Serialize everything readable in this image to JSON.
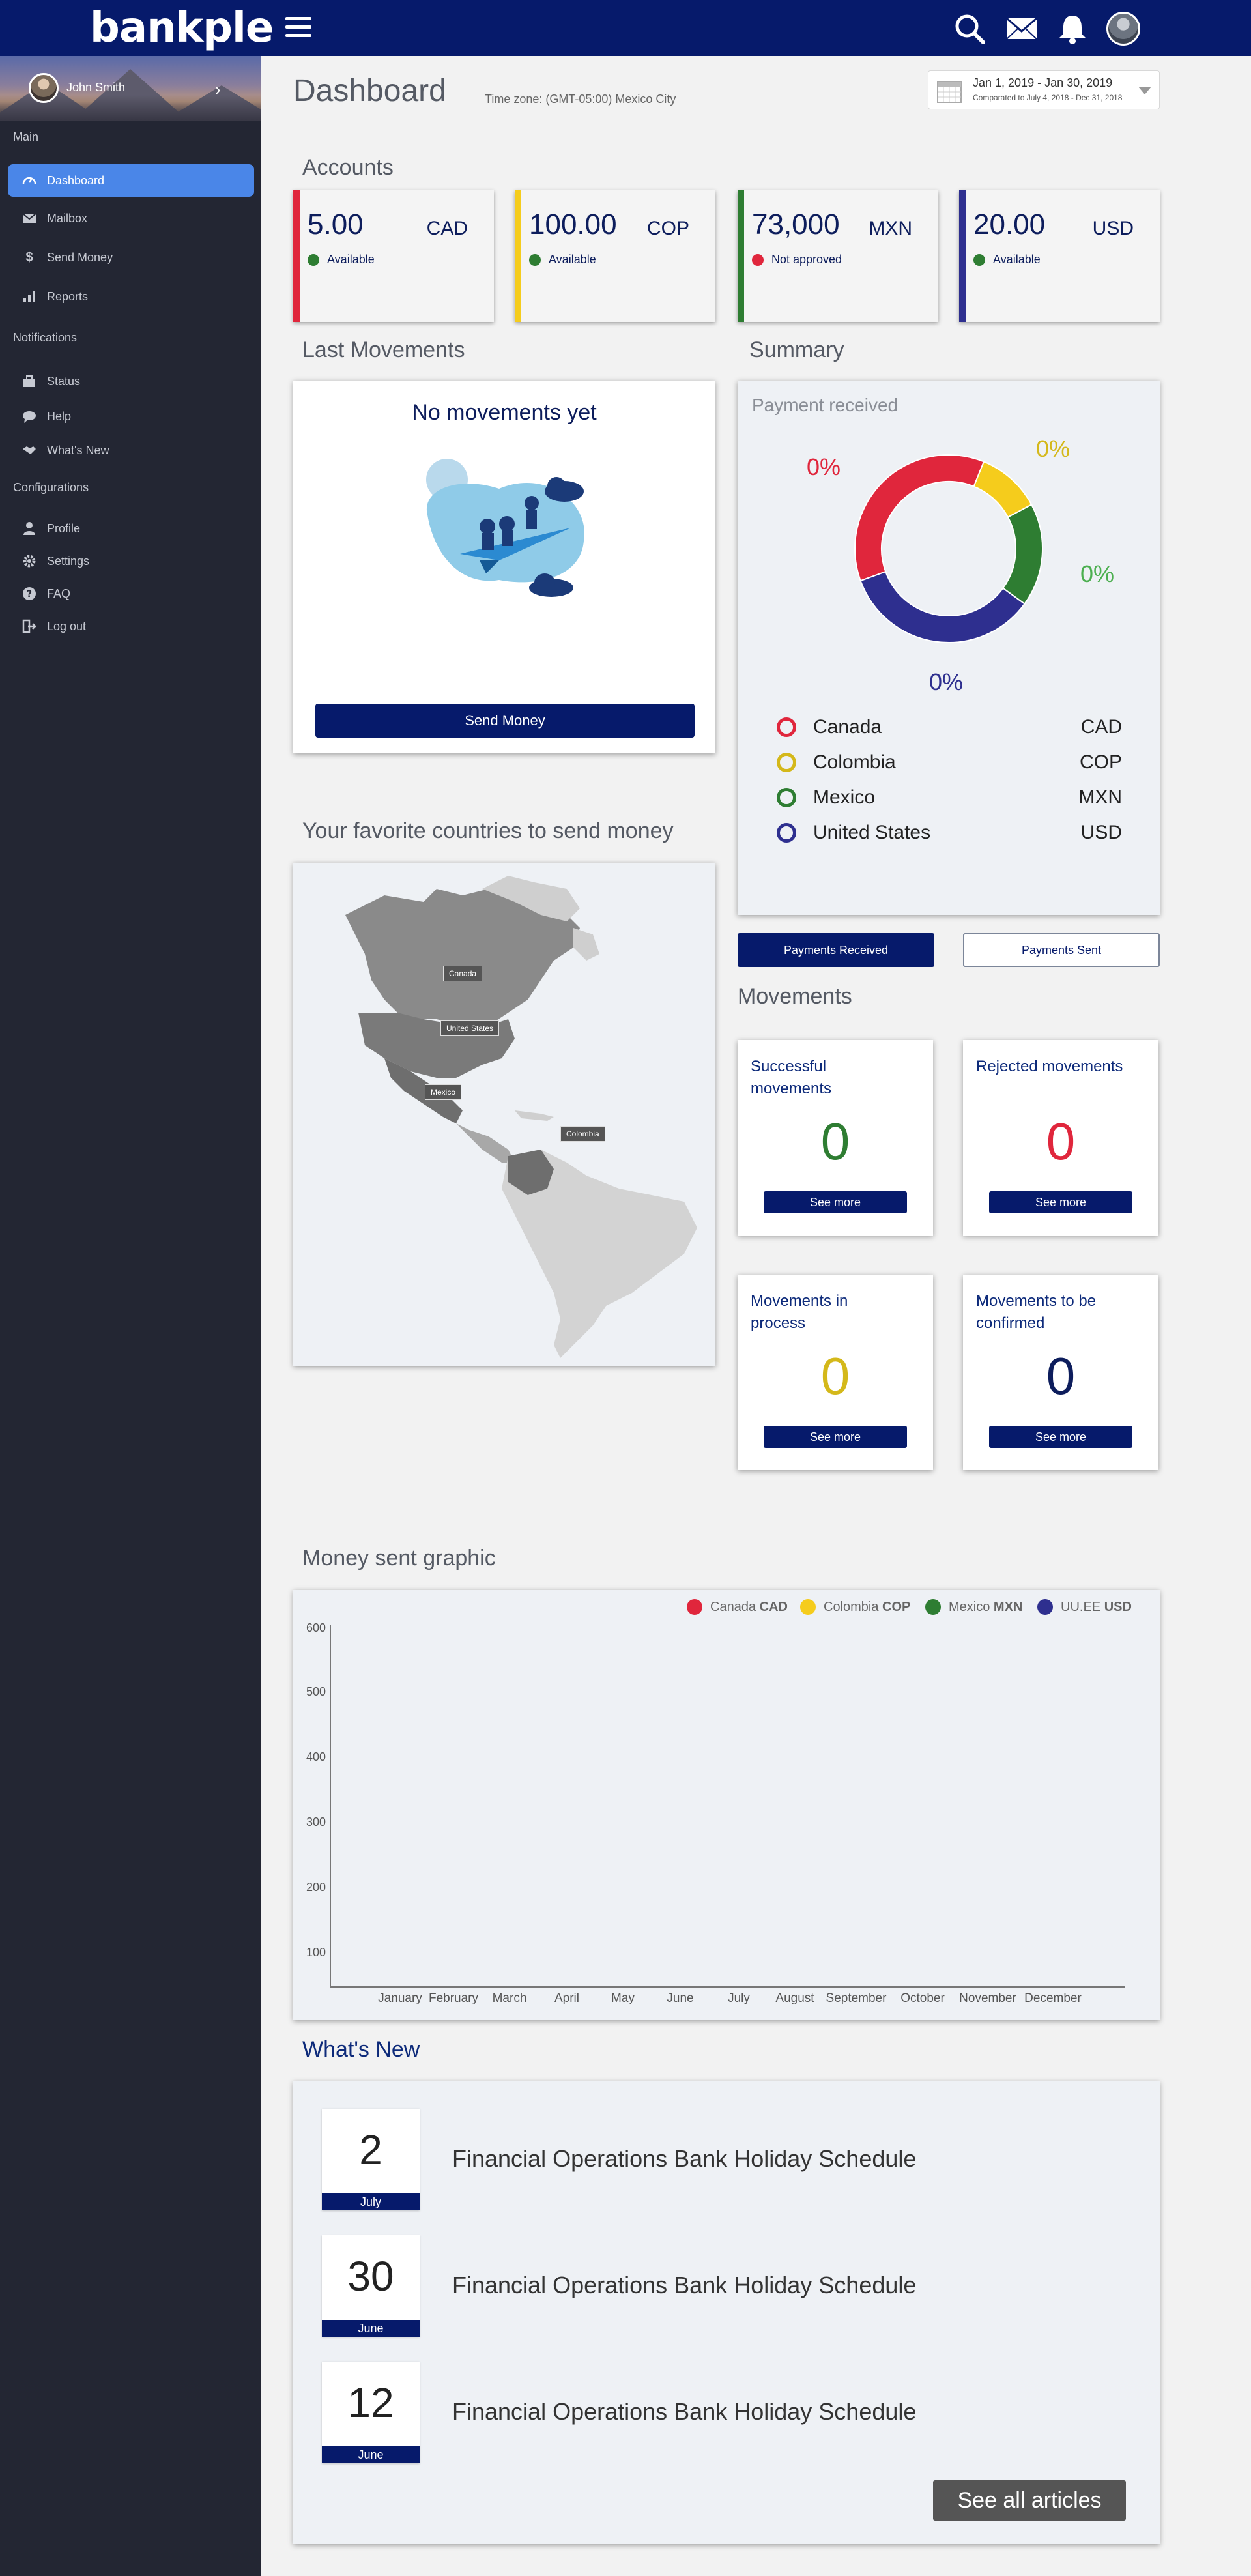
{
  "app": {
    "logo": "bankple"
  },
  "sidebar": {
    "user_name": "John Smith",
    "sections": {
      "main": "Main",
      "notifications": "Notifications",
      "configurations": "Configurations"
    },
    "items": [
      {
        "label": "Dashboard",
        "icon": "speedometer-icon"
      },
      {
        "label": "Mailbox",
        "icon": "envelope-icon"
      },
      {
        "label": "Send Money",
        "icon": "money-icon"
      },
      {
        "label": "Reports",
        "icon": "bar-chart-icon"
      },
      {
        "label": "Status",
        "icon": "briefcase-icon"
      },
      {
        "label": "Help",
        "icon": "chat-bubble-icon"
      },
      {
        "label": "What's New",
        "icon": "handshake-icon"
      },
      {
        "label": "Profile",
        "icon": "user-icon"
      },
      {
        "label": "Settings",
        "icon": "gear-icon"
      },
      {
        "label": "FAQ",
        "icon": "question-icon"
      },
      {
        "label": "Log out",
        "icon": "logout-icon"
      }
    ]
  },
  "header": {
    "title": "Dashboard",
    "timezone": "Time zone: (GMT-05:00) Mexico City",
    "date_range": "Jan 1, 2019 - Jan 30, 2019",
    "date_compare": "Comparated to July 4, 2018 - Dec 31, 2018"
  },
  "accounts": {
    "title": "Accounts",
    "cards": [
      {
        "amount": "5.00",
        "currency": "CAD",
        "status": "Available",
        "color": "#e0263c",
        "status_color": "#2e7d32"
      },
      {
        "amount": "100.00",
        "currency": "COP",
        "status": "Available",
        "color": "#f5cc1c",
        "status_color": "#2e7d32"
      },
      {
        "amount": "73,000",
        "currency": "MXN",
        "status": "Not approved",
        "color": "#2e7d32",
        "status_color": "#e0263c"
      },
      {
        "amount": "20.00",
        "currency": "USD",
        "status": "Available",
        "color": "#2e2f8f",
        "status_color": "#2e7d32"
      }
    ]
  },
  "last_movements": {
    "title": "Last Movements",
    "empty_text": "No movements yet",
    "button": "Send Money"
  },
  "summary": {
    "title": "Summary",
    "subtitle": "Payment received",
    "percentages": {
      "canada": "0%",
      "colombia": "0%",
      "mexico": "0%",
      "usa": "0%"
    },
    "legend": [
      {
        "country": "Canada",
        "code": "CAD",
        "color": "#e0263c"
      },
      {
        "country": "Colombia",
        "code": "COP",
        "color": "#d4b81a"
      },
      {
        "country": "Mexico",
        "code": "MXN",
        "color": "#2e7d32"
      },
      {
        "country": "United States",
        "code": "USD",
        "color": "#2e2f8f"
      }
    ],
    "buttons": {
      "received": "Payments Received",
      "sent": "Payments Sent"
    }
  },
  "favorites": {
    "title": "Your favorite countries to send money",
    "labels": {
      "canada": "Canada",
      "usa": "United States",
      "mexico": "Mexico",
      "colombia": "Colombia"
    }
  },
  "movements": {
    "title": "Movements",
    "cards": [
      {
        "title": "Successful movements",
        "count": "0",
        "color": "#2e7d32",
        "button": "See more"
      },
      {
        "title": "Rejected movements",
        "count": "0",
        "color": "#e0263c",
        "button": "See more"
      },
      {
        "title": "Movements in process",
        "count": "0",
        "color": "#d4b81a",
        "button": "See more"
      },
      {
        "title": "Movements to be confirmed",
        "count": "0",
        "color": "#0d1d5c",
        "button": "See more"
      }
    ]
  },
  "money_sent_graphic": {
    "title": "Money sent graphic",
    "legend": [
      {
        "name": "Canada",
        "code": "CAD",
        "color": "#e0263c"
      },
      {
        "name": "Colombia",
        "code": "COP",
        "color": "#f5cc1c"
      },
      {
        "name": "Mexico",
        "code": "MXN",
        "color": "#2e7d32"
      },
      {
        "name": "UU.EE",
        "code": "USD",
        "color": "#2e2f8f"
      }
    ],
    "y_ticks": [
      "600",
      "500",
      "400",
      "300",
      "200",
      "100"
    ],
    "months": [
      "January",
      "February",
      "March",
      "April",
      "May",
      "June",
      "July",
      "August",
      "September",
      "October",
      "November",
      "December"
    ]
  },
  "whats_new": {
    "title": "What's New",
    "items": [
      {
        "day": "2",
        "month": "July",
        "title": "Financial Operations Bank Holiday Schedule"
      },
      {
        "day": "30",
        "month": "June",
        "title": "Financial Operations Bank Holiday Schedule"
      },
      {
        "day": "12",
        "month": "June",
        "title": "Financial Operations Bank Holiday Schedule"
      }
    ],
    "see_all": "See all articles"
  }
}
